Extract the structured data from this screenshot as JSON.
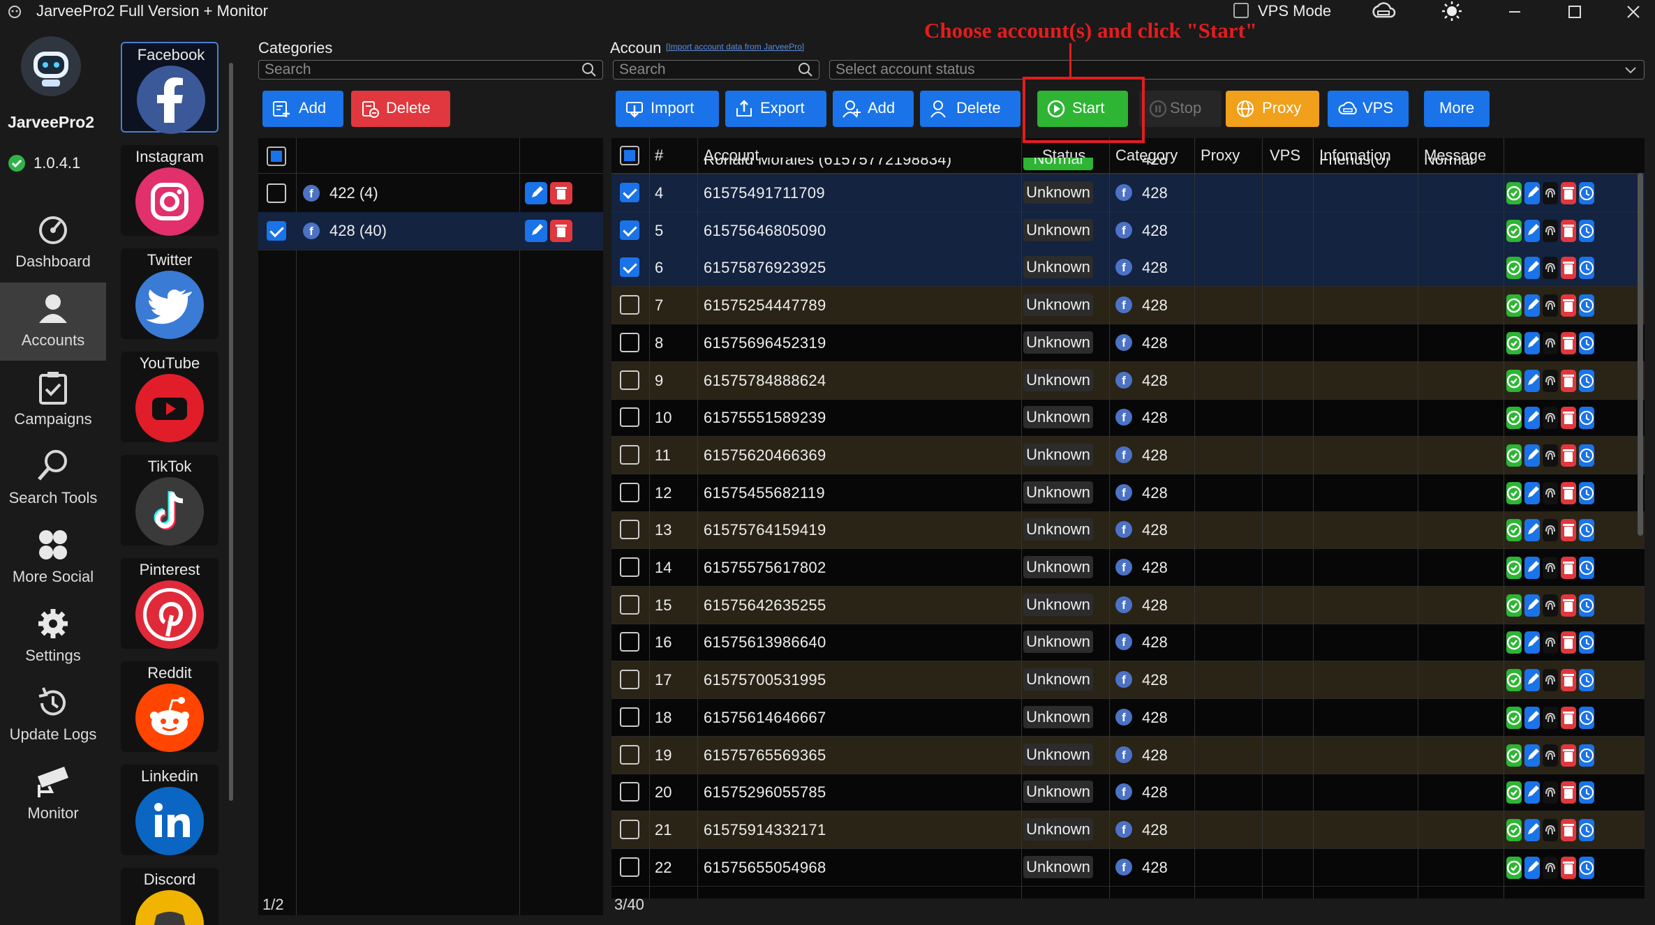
{
  "window": {
    "title": "JarveePro2 Full Version + Monitor",
    "vps_mode_label": "VPS Mode"
  },
  "sidebar": {
    "app_name": "JarveePro2",
    "version": "1.0.4.1",
    "nav": [
      {
        "label": "Dashboard",
        "icon": "dashboard-icon"
      },
      {
        "label": "Accounts",
        "icon": "accounts-icon",
        "active": true
      },
      {
        "label": "Campaigns",
        "icon": "campaigns-icon"
      },
      {
        "label": "Search Tools",
        "icon": "search-tools-icon"
      },
      {
        "label": "More Social",
        "icon": "more-social-icon"
      },
      {
        "label": "Settings",
        "icon": "settings-icon"
      },
      {
        "label": "Update Logs",
        "icon": "update-logs-icon"
      },
      {
        "label": "Monitor",
        "icon": "monitor-icon"
      }
    ]
  },
  "social": [
    {
      "label": "Facebook",
      "color": "#3b5998",
      "active": true
    },
    {
      "label": "Instagram",
      "color": "#e1306c"
    },
    {
      "label": "Twitter",
      "color": "#3a7bd5"
    },
    {
      "label": "YouTube",
      "color": "#e11d2a"
    },
    {
      "label": "TikTok",
      "color": "#3a3a3a"
    },
    {
      "label": "Pinterest",
      "color": "#e02a3a"
    },
    {
      "label": "Reddit",
      "color": "#ff4500"
    },
    {
      "label": "Linkedin",
      "color": "#0a66c2"
    },
    {
      "label": "Discord",
      "color": "#f0b400"
    }
  ],
  "categories": {
    "title": "Categories",
    "search_placeholder": "Search",
    "add_label": "Add",
    "delete_label": "Delete",
    "rows": [
      {
        "label": "422 (4)",
        "checked": false
      },
      {
        "label": "428 (40)",
        "checked": true
      }
    ],
    "footer": "1/2"
  },
  "accounts": {
    "title": "Accoun",
    "import_link": "[Import account data from JarveePro]",
    "search_placeholder": "Search",
    "status_placeholder": "Select account status",
    "toolbar": {
      "import": "Import",
      "export": "Export",
      "add": "Add",
      "delete": "Delete",
      "start": "Start",
      "stop": "Stop",
      "proxy": "Proxy",
      "vps": "VPS",
      "more": "More"
    },
    "columns": [
      "#",
      "Account",
      "Status",
      "Category",
      "Proxy",
      "VPS",
      "Infomation",
      "Message"
    ],
    "partial_row": {
      "account": "Ronald Morales (61575772198834)",
      "status": "Normal",
      "category": "428",
      "information": "Friends(0)",
      "message": "Normal"
    },
    "rows": [
      {
        "num": "4",
        "account": "61575491711709",
        "status": "Unknown",
        "category": "428",
        "checked": true
      },
      {
        "num": "5",
        "account": "61575646805090",
        "status": "Unknown",
        "category": "428",
        "checked": true
      },
      {
        "num": "6",
        "account": "61575876923925",
        "status": "Unknown",
        "category": "428",
        "checked": true
      },
      {
        "num": "7",
        "account": "61575254447789",
        "status": "Unknown",
        "category": "428",
        "checked": false
      },
      {
        "num": "8",
        "account": "61575696452319",
        "status": "Unknown",
        "category": "428",
        "checked": false
      },
      {
        "num": "9",
        "account": "61575784888624",
        "status": "Unknown",
        "category": "428",
        "checked": false
      },
      {
        "num": "10",
        "account": "61575551589239",
        "status": "Unknown",
        "category": "428",
        "checked": false
      },
      {
        "num": "11",
        "account": "61575620466369",
        "status": "Unknown",
        "category": "428",
        "checked": false
      },
      {
        "num": "12",
        "account": "61575455682119",
        "status": "Unknown",
        "category": "428",
        "checked": false
      },
      {
        "num": "13",
        "account": "61575764159419",
        "status": "Unknown",
        "category": "428",
        "checked": false
      },
      {
        "num": "14",
        "account": "61575575617802",
        "status": "Unknown",
        "category": "428",
        "checked": false
      },
      {
        "num": "15",
        "account": "61575642635255",
        "status": "Unknown",
        "category": "428",
        "checked": false
      },
      {
        "num": "16",
        "account": "61575613986640",
        "status": "Unknown",
        "category": "428",
        "checked": false
      },
      {
        "num": "17",
        "account": "61575700531995",
        "status": "Unknown",
        "category": "428",
        "checked": false
      },
      {
        "num": "18",
        "account": "61575614646667",
        "status": "Unknown",
        "category": "428",
        "checked": false
      },
      {
        "num": "19",
        "account": "61575765569365",
        "status": "Unknown",
        "category": "428",
        "checked": false
      },
      {
        "num": "20",
        "account": "61575296055785",
        "status": "Unknown",
        "category": "428",
        "checked": false
      },
      {
        "num": "21",
        "account": "61575914332171",
        "status": "Unknown",
        "category": "428",
        "checked": false
      },
      {
        "num": "22",
        "account": "61575655054968",
        "status": "Unknown",
        "category": "428",
        "checked": false
      }
    ],
    "footer": "3/40"
  },
  "annotation": "Choose account(s) and click \"Start\""
}
